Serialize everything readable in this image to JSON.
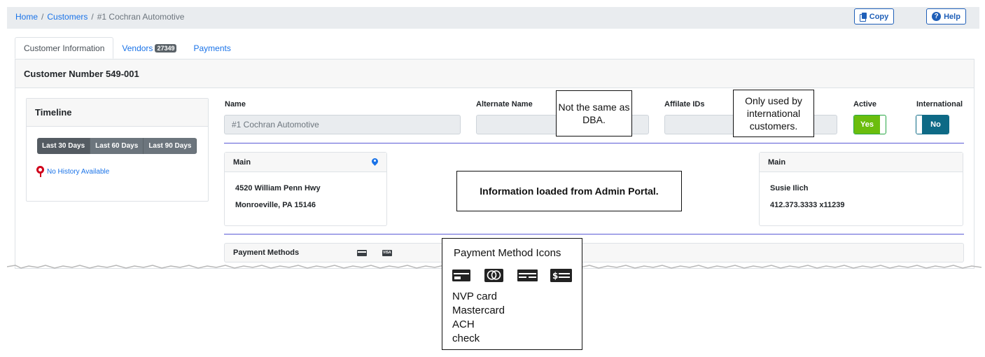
{
  "breadcrumb": {
    "home": "Home",
    "customers": "Customers",
    "current": "#1 Cochran Automotive",
    "separator": "/"
  },
  "toolbar": {
    "copy_label": "Copy",
    "help_label": "Help"
  },
  "tabs": [
    {
      "label": "Customer Information",
      "active": true
    },
    {
      "label": "Vendors",
      "badge": "27349",
      "active": false
    },
    {
      "label": "Payments",
      "active": false
    }
  ],
  "card": {
    "title": "Customer Number 549-001"
  },
  "timeline": {
    "title": "Timeline",
    "ranges": [
      "Last 30 Days",
      "Last 60 Days",
      "Last 90 Days"
    ],
    "selected_range": "Last 30 Days",
    "empty_text": "No History Available"
  },
  "fields": {
    "name_label": "Name",
    "name_value": "#1 Cochran Automotive",
    "alternate_name_label": "Alternate Name",
    "alternate_name_value": "",
    "affiliate_ids_label": "Affilate IDs",
    "affiliate_ids_value": "",
    "active_label": "Active",
    "active_value": "Yes",
    "international_label": "International",
    "international_value": "No"
  },
  "address": {
    "title": "Main",
    "line1": "4520 William Penn Hwy",
    "line2": "Monroeville, PA 15146"
  },
  "contact": {
    "title": "Main",
    "name": "Susie Ilich",
    "phone": "412.373.3333 x11239"
  },
  "payment_methods": {
    "label": "Payment Methods",
    "icons": [
      "nvp-card-icon",
      "visa-card-icon"
    ]
  },
  "callouts": {
    "alternate_name": "Not the same as DBA.",
    "international": "Only used by international customers.",
    "admin_portal": "Information loaded from Admin Portal.",
    "legend_title": "Payment Method Icons",
    "legend_items": [
      "NVP card",
      "Mastercard",
      "ACH",
      "check"
    ]
  },
  "colors": {
    "link": "#1a73e8",
    "active_toggle": "#6bbd0d",
    "international_toggle": "#0e6a86",
    "divider": "#5b5bd6"
  }
}
